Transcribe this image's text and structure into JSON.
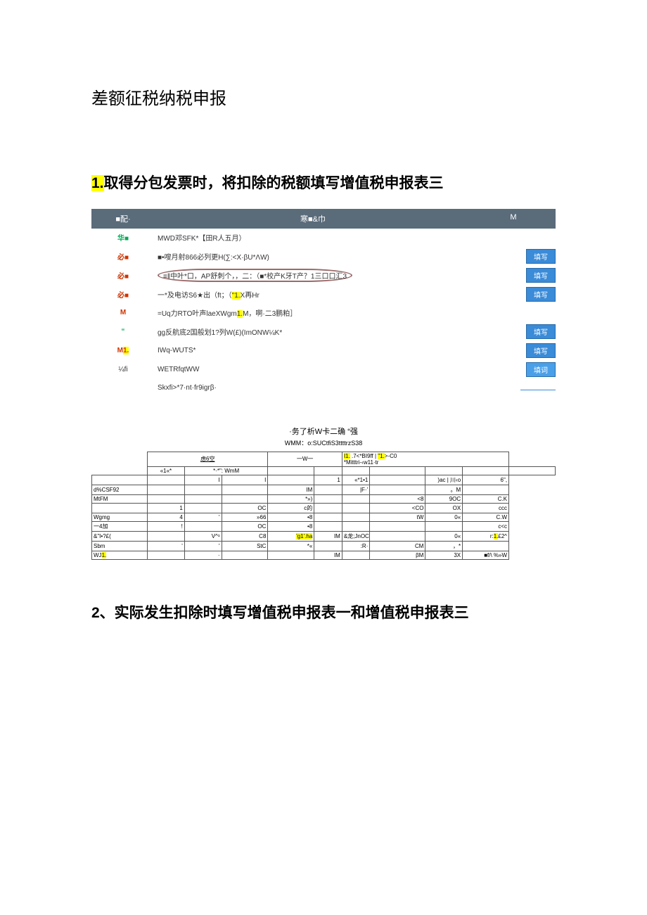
{
  "title": "差额征税纳税申报",
  "section1": {
    "num": "1.",
    "text": "取得分包发票时，将扣除的税额填写增值税申报表三"
  },
  "form": {
    "head_a": "■配·",
    "head_b": "寒■&巾",
    "head_c": "M",
    "rows": [
      {
        "a": "华■",
        "b": "MWD邓SFK*【田R人五月）",
        "btn": "",
        "cls": "green"
      },
      {
        "a": "必■",
        "b": "■•嗖月射866必列更H(∑:<X·βU*ΛW)",
        "btn": "填写"
      },
      {
        "a": "必■",
        "b_circled": "≡‖中叶*口，AP舒刺个，，二：（■*校产K牙T产？1三口口汇3",
        "btn": "填写"
      },
      {
        "a": "必■",
        "b_pre": "一*及电访S6★出（ft；（",
        "b_hl": "\"1.",
        "b_post": "X再Hr",
        "btn": "填写"
      },
      {
        "a": "M",
        "b_pre": "=Uq力RTO叶声laeXWgm",
        "b_hl": "1.",
        "b_post": "M，啊·二3鹏粕］",
        "btn": ""
      },
      {
        "a": "“",
        "b": "gg反航底2国般划1?列W(£)(ImONW¼K*",
        "btn": "填写",
        "cls": "green"
      },
      {
        "a": "M1.",
        "b": "IWq-WUTS*",
        "btn": "填写",
        "a_hl": "1."
      },
      {
        "a": "¼fi",
        "b": "WETRfqtWW",
        "btn": "填词"
      },
      {
        "a": "",
        "b": "Skxfi>*7·nt·fr9igrβ·",
        "link": true
      }
    ]
  },
  "table2": {
    "title": "·务了析W卡二确 “强",
    "sub": "WMM：o:SUCtfiS3ttttrzS38",
    "h_left": "虑6空",
    "h_w": "一W一",
    "h_br_pre": "I1.",
    "h_br_mid": ".7<*BI9ff | ",
    "h_br_hl": "\"1.",
    "h_br_post": ">-C0",
    "h_m": "*Mitttri-‹w11·tr",
    "h_c1": "«1«*",
    "h_c2": "*·*\": WmM"
  },
  "chart_data": {
    "type": "table",
    "note": "Garbled/low-quality scan — values approximated from visible glyphs",
    "header_groups": [
      "虑6空",
      "一W一",
      "I1. .7<*BI9ff | \"1.>-C0 *Mitttri-‹w11·tr"
    ],
    "columns": [
      "label",
      "c1",
      "c2",
      "c3",
      "c4",
      "c5",
      "c6",
      "c7",
      "c8",
      "c9"
    ],
    "rows": [
      {
        "label": "",
        "c1": "",
        "c2": "I",
        "c3": "I",
        "c4": "",
        "c5": "1",
        "c6": "«*1•1",
        "c7": "",
        "c8": ")ac | 川‹o",
        "c9": "6\","
      },
      {
        "label": "d%CSF92",
        "c1": "",
        "c2": "",
        "c3": "",
        "c4": "IM",
        "c5": "",
        "c6": "|F·‛",
        "c7": "",
        "c8": "。M",
        "c9": ""
      },
      {
        "label": "MtFM",
        "c1": "",
        "c2": "",
        "c3": "",
        "c4": "*»)",
        "c5": "",
        "c6": "",
        "c7": "<8",
        "c8": "9OC",
        "c9": "C.K"
      },
      {
        "label": "",
        "c1": "1",
        "c2": "",
        "c3": "OC",
        "c4": "c的",
        "c5": "",
        "c6": "",
        "c7": "<CO",
        "c8": "OX",
        "c9": "ccc"
      },
      {
        "label": "Wgmg",
        "c1": "4",
        "c2": "'",
        "c3": "»66",
        "c4": "•8",
        "c5": "",
        "c6": "",
        "c7": "tW",
        "c8": "0«",
        "c9": "C.W"
      },
      {
        "label": "一4加",
        "c1": "!",
        "c2": "",
        "c3": "OC",
        "c4": "•8",
        "c5": "",
        "c6": "",
        "c7": "",
        "c8": "",
        "c9": "c<c"
      },
      {
        "label": "&\"I•?£(",
        "c1": "",
        "c2": "V^¹",
        "c3": "C8",
        "c4": "'g1'.ha",
        "c5": "IM",
        "c6": "&龙;JnOC",
        "c7": "",
        "c8": "0«",
        "c9": "r:1.£2^"
      },
      {
        "label": "Sbm",
        "c1": "'",
        "c2": "'",
        "c3": "StC",
        "c4": "*«",
        "c5": "",
        "c6": ":R·",
        "c7": "CM",
        "c8": "，*",
        "c9": ""
      },
      {
        "label": "WJ1.",
        "c1": "",
        "c2": "·",
        "c3": "",
        "c4": "",
        "c5": "IM",
        "c6": "",
        "c7": "βM",
        "c8": "3X",
        "c9": "■f/\\ %»W"
      }
    ]
  },
  "section2": "2、实际发生扣除时填写增值税申报表一和增值税申报表三"
}
